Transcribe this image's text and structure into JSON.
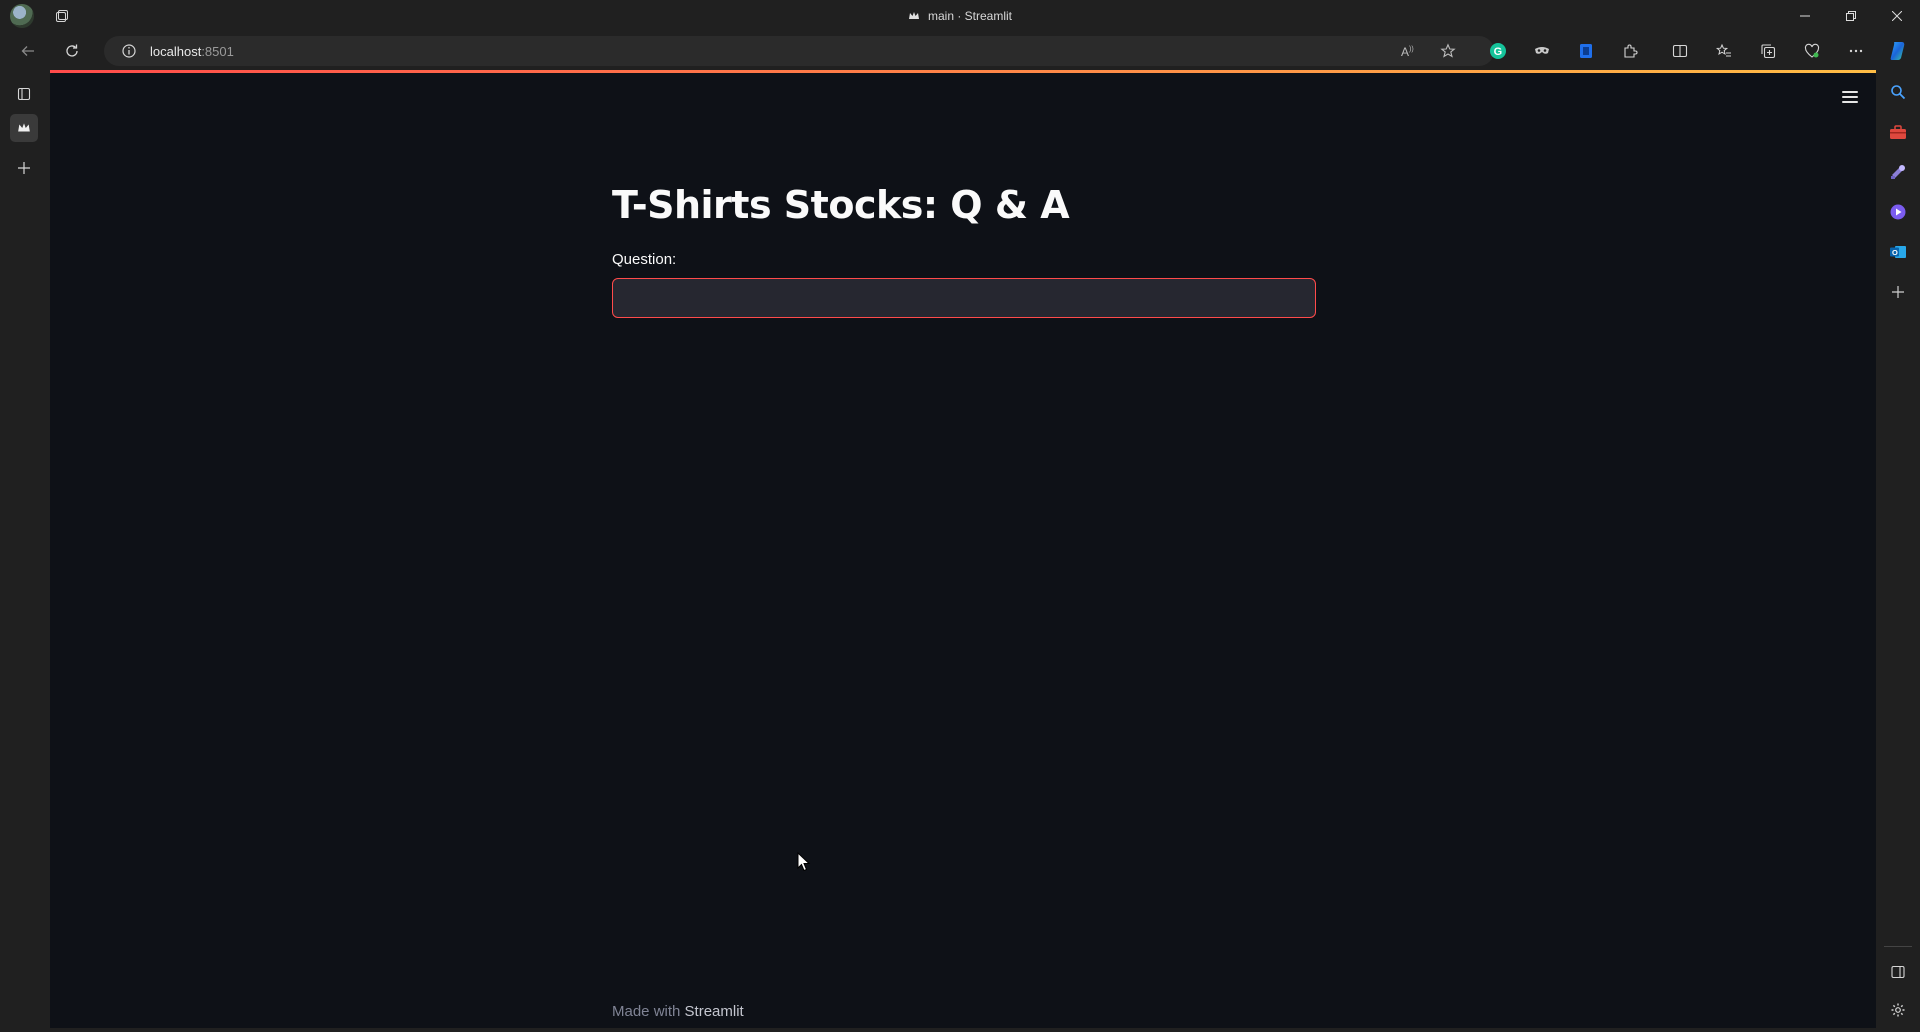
{
  "browser": {
    "window_title": "main · Streamlit",
    "address": {
      "host": "localhost",
      "port": ":8501"
    },
    "window_controls": [
      "minimize",
      "restore",
      "close"
    ]
  },
  "toolbar": {
    "left_icons": [
      "back-icon",
      "refresh-icon",
      "site-info-icon"
    ],
    "right_icons": [
      "read-aloud-icon",
      "favorite-star-icon",
      "grammarly-icon",
      "extension-icon",
      "extension-icon",
      "extensions-icon",
      "split-screen-icon",
      "favorites-icon",
      "collections-icon",
      "browser-essentials-icon",
      "more-icon",
      "copilot-icon"
    ]
  },
  "left_strip": {
    "icons": [
      "tab-actions-icon",
      "streamlit-tab-icon",
      "new-tab-icon"
    ]
  },
  "right_strip": {
    "icons": [
      "search-icon",
      "tools-icon",
      "games-icon",
      "copilot-app-icon",
      "outlook-icon",
      "add-icon",
      "sidebar-toggle-icon",
      "settings-icon"
    ]
  },
  "app": {
    "title": "T-Shirts Stocks: Q & A",
    "question_label": "Question:",
    "question_value": "",
    "footer_prefix": "Made with",
    "footer_brand": "Streamlit",
    "colors": {
      "background": "#0e1117",
      "input_border": "#ff4b4b",
      "input_bg": "#262730",
      "accent_gradient": [
        "#ff4b4b",
        "#ffbd45"
      ]
    }
  }
}
